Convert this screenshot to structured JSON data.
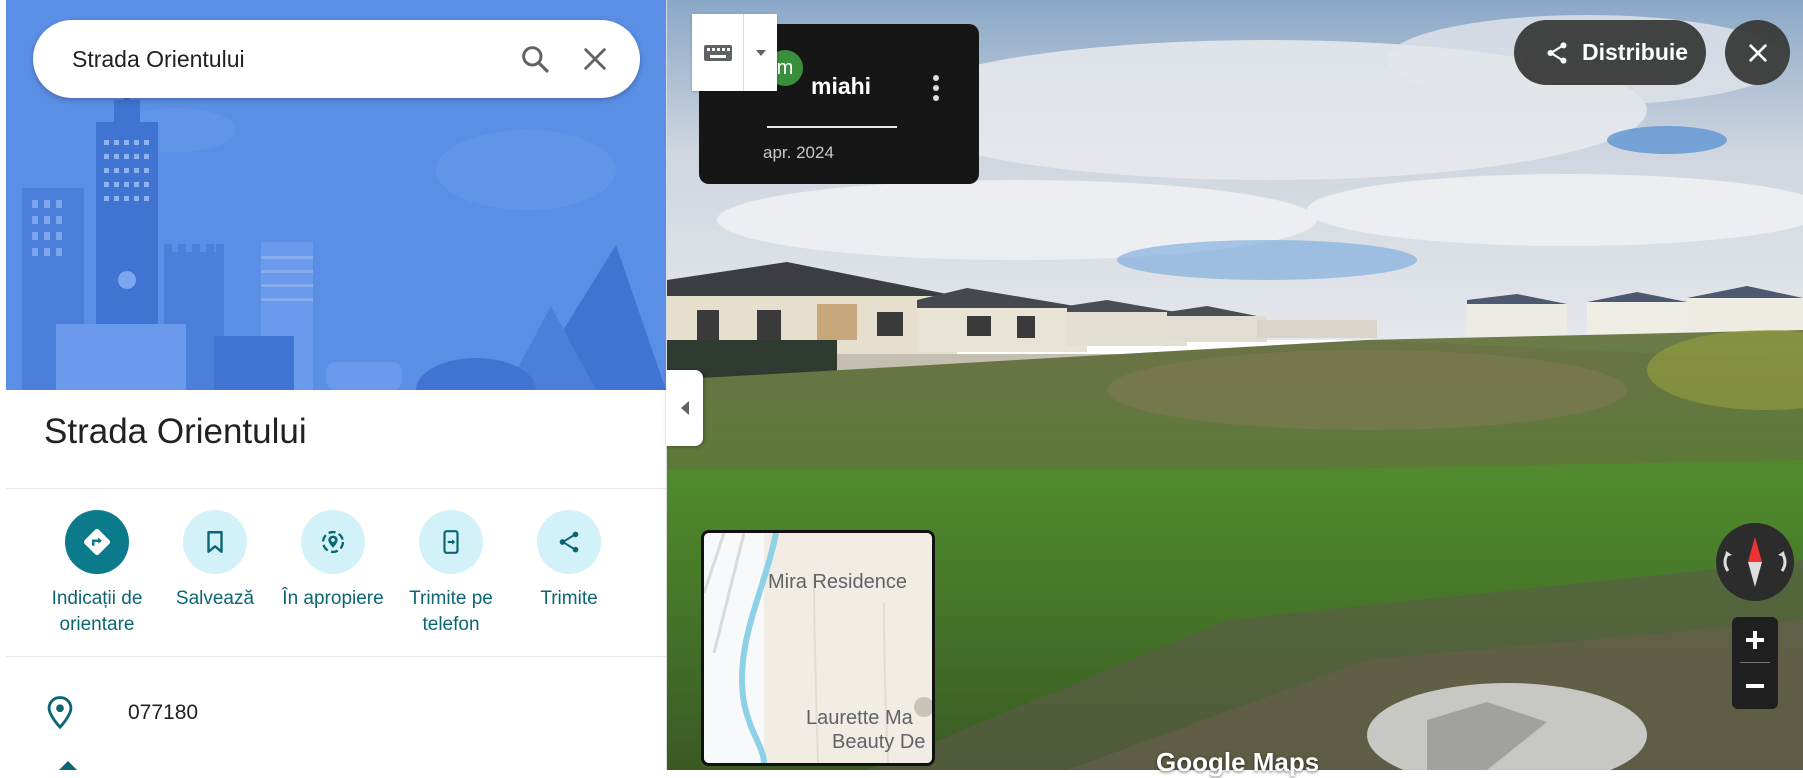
{
  "search": {
    "value": "Strada Orientului"
  },
  "place": {
    "title": "Strada Orientului"
  },
  "actions": [
    {
      "label": "Indicații de orientare",
      "icon": "directions-icon"
    },
    {
      "label": "Salvează",
      "icon": "bookmark-icon"
    },
    {
      "label": "În apropiere",
      "icon": "nearby-icon"
    },
    {
      "label": "Trimite pe telefon",
      "icon": "send-to-phone-icon"
    },
    {
      "label": "Trimite",
      "icon": "share-icon"
    }
  ],
  "info": {
    "postal_code": "077180"
  },
  "streetview": {
    "author_initial": "m",
    "author": "miahi",
    "date": "apr. 2024",
    "share_label": "Distribuie"
  },
  "minimap": {
    "label_1": "Mira Residence",
    "label_2": "Laurette Ma",
    "label_3": "Beauty De"
  },
  "branding": {
    "logo": "Google Maps"
  },
  "colors": {
    "accent": "#0b7a8a",
    "accent_light": "#d2f1f9",
    "hero_bg": "#5a8ee6"
  }
}
